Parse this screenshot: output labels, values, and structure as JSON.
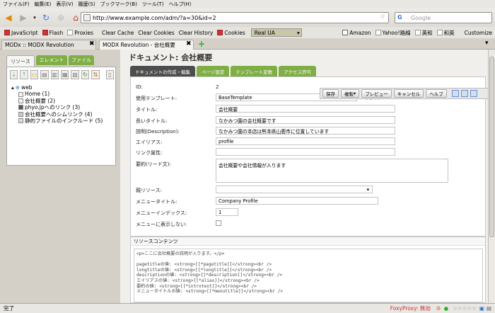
{
  "menu": [
    "ファイル(F)",
    "編集(E)",
    "表示(V)",
    "履歴(S)",
    "ブックマーク(B)",
    "ツール(T)",
    "ヘルプ(H)"
  ],
  "url": "http://www.example.com/adm/?a=30&id=2",
  "search_placeholder": "Google",
  "toolbar": {
    "items": [
      {
        "label": "JavaScript",
        "checked": true
      },
      {
        "label": "Flash",
        "checked": true
      },
      {
        "label": "Proxies",
        "checked": false
      }
    ],
    "links": [
      "Clear Cache",
      "Clear Cookies",
      "Clear History"
    ],
    "cookies": "Cookies",
    "ua": "Real UA",
    "bookmarks": [
      "Amazon",
      "Yahoo!路線",
      "英和",
      "和英"
    ],
    "customize": "Customize"
  },
  "tabs": [
    "MODx :: MODX Revolution",
    "MODX Revolution - 会社概要"
  ],
  "left": {
    "tabs": [
      "リソース",
      "エレメント",
      "ファイル"
    ],
    "tree": {
      "root": "web",
      "items": [
        "Home (1)",
        "会社概要 (2)",
        "phyo.jpへのリンク (3)",
        "会社概要へのシムリンク (4)",
        "静的ファイルのインクルード (5)"
      ]
    }
  },
  "page": {
    "title": "ドキュメント: 会社概要",
    "tabs": [
      "ドキュメントの作成・編集",
      "ページ設定",
      "テンプレート変数",
      "アクセス許可"
    ]
  },
  "actions": [
    "保存",
    "複製",
    "プレビュー",
    "キャンセル",
    "ヘルプ"
  ],
  "form": {
    "id_label": "ID:",
    "id_value": "2",
    "template_label": "使用テンプレート:",
    "template_value": "BaseTemplate",
    "template_hint": "前を取る",
    "title_label": "タイトル:",
    "title_value": "会社概要",
    "longtitle_label": "長いタイトル:",
    "longtitle_value": "なかみつ園の会社概要です",
    "desc_label": "説明(Description):",
    "desc_value": "なかみつ園の本店は熊本県山鹿市に位置しています",
    "alias_label": "エイリアス:",
    "alias_value": "profile",
    "link_label": "リンク属性:",
    "link_value": "",
    "intro_label": "要約(リード文):",
    "intro_value": "会社概要や会社情報が入ります",
    "parent_label": "親リソース:",
    "parent_value": "",
    "menutitle_label": "メニュータイトル:",
    "menutitle_value": "Company Profile",
    "menuindex_label": "メニューインデックス:",
    "menuindex_value": "1",
    "hide_label": "メニューに表示しない:"
  },
  "content": {
    "heading": "リソースコンテンツ",
    "lines": [
      "<p>ここに会社概要の説明が入ります。</p>",
      "",
      "pagetitleの値: <strong>[[*pagetitle]]</strong><br />",
      "longtitleの値: <strong>[[*longtitle]]</strong><br />",
      "descriptionの値: <strong>[[*description]]</strong><br />",
      "エイリアスの値: <strong>[[*alias]]</strong><br />",
      "要約の値: <strong>[[*introtext]]</strong><br />",
      "メニュータイトルの値: <strong>[[*menutitle]]</strong><br />"
    ]
  },
  "status": {
    "left": "完了",
    "proxy": "FoxyProxy: 無効"
  }
}
